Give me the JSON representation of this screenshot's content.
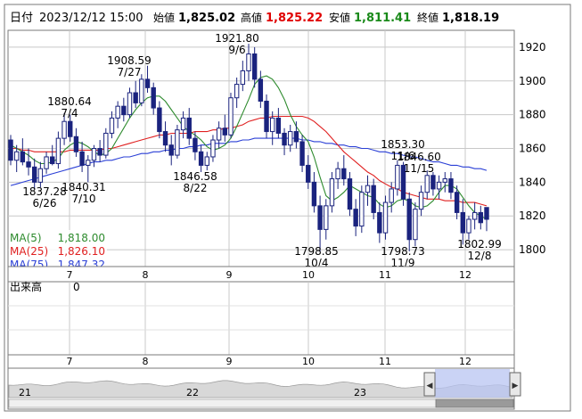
{
  "header": {
    "date_label": "日付",
    "datetime": "2023/12/12 15:00",
    "open_label": "始値",
    "open": "1,825.02",
    "high_label": "高値",
    "high": "1,825.22",
    "low_label": "安値",
    "low": "1,811.41",
    "close_label": "終値",
    "close": "1,818.19"
  },
  "colors": {
    "up": "#1a237e",
    "down": "#1a237e",
    "ma5": "#2e8b2e",
    "ma25": "#e02020",
    "ma75": "#2a3fd6",
    "high_text": "#e00000",
    "low_text": "#1a8a1a",
    "grid": "#c8c8c8",
    "frame": "#666666"
  },
  "chart_data": {
    "type": "candlestick",
    "y_ticks": [
      1800,
      1820,
      1840,
      1860,
      1880,
      1900,
      1920
    ],
    "ylim": [
      1790,
      1930
    ],
    "x_month_ticks": [
      "7",
      "8",
      "9",
      "10",
      "11",
      "12"
    ],
    "grid": true,
    "legend": [
      {
        "name": "MA(5)",
        "value": "1,818.00",
        "color": "#2e8b2e"
      },
      {
        "name": "MA(25)",
        "value": "1,826.10",
        "color": "#e02020"
      },
      {
        "name": "MA(75)",
        "value": "1,847.32",
        "color": "#2a3fd6"
      }
    ],
    "annotations": [
      {
        "value": "1880.64",
        "date": "7/4"
      },
      {
        "value": "1837.28",
        "date": "6/26"
      },
      {
        "value": "1840.31",
        "date": "7/10"
      },
      {
        "value": "1908.59",
        "date": "7/27"
      },
      {
        "value": "1846.58",
        "date": "8/22"
      },
      {
        "value": "1921.80",
        "date": "9/6"
      },
      {
        "value": "1798.85",
        "date": "10/4"
      },
      {
        "value": "1853.30",
        "date": "11/6"
      },
      {
        "value": "1846.60",
        "date": "11/15"
      },
      {
        "value": "1798.73",
        "date": "11/9"
      },
      {
        "value": "1802.99",
        "date": "12/8"
      }
    ],
    "candles": [
      [
        1865,
        1868,
        1850,
        1853
      ],
      [
        1853,
        1862,
        1846,
        1858
      ],
      [
        1858,
        1866,
        1850,
        1852
      ],
      [
        1852,
        1860,
        1844,
        1849
      ],
      [
        1849,
        1854,
        1836,
        1840
      ],
      [
        1840,
        1852,
        1837,
        1848
      ],
      [
        1848,
        1858,
        1845,
        1855
      ],
      [
        1855,
        1862,
        1850,
        1851
      ],
      [
        1851,
        1870,
        1848,
        1866
      ],
      [
        1866,
        1881,
        1862,
        1876
      ],
      [
        1876,
        1880,
        1864,
        1867
      ],
      [
        1867,
        1872,
        1855,
        1858
      ],
      [
        1858,
        1864,
        1846,
        1850
      ],
      [
        1850,
        1856,
        1840,
        1853
      ],
      [
        1853,
        1862,
        1849,
        1860
      ],
      [
        1860,
        1865,
        1852,
        1856
      ],
      [
        1856,
        1872,
        1854,
        1869
      ],
      [
        1869,
        1882,
        1866,
        1878
      ],
      [
        1878,
        1888,
        1872,
        1885
      ],
      [
        1885,
        1890,
        1876,
        1880
      ],
      [
        1880,
        1896,
        1878,
        1893
      ],
      [
        1893,
        1900,
        1884,
        1887
      ],
      [
        1887,
        1904,
        1885,
        1901
      ],
      [
        1901,
        1909,
        1893,
        1896
      ],
      [
        1896,
        1899,
        1880,
        1884
      ],
      [
        1884,
        1888,
        1866,
        1870
      ],
      [
        1870,
        1876,
        1858,
        1862
      ],
      [
        1862,
        1868,
        1850,
        1856
      ],
      [
        1856,
        1874,
        1854,
        1871
      ],
      [
        1871,
        1882,
        1866,
        1878
      ],
      [
        1878,
        1884,
        1862,
        1866
      ],
      [
        1866,
        1870,
        1853,
        1858
      ],
      [
        1858,
        1862,
        1846,
        1850
      ],
      [
        1850,
        1858,
        1847,
        1855
      ],
      [
        1855,
        1868,
        1852,
        1865
      ],
      [
        1865,
        1876,
        1860,
        1872
      ],
      [
        1872,
        1880,
        1864,
        1868
      ],
      [
        1868,
        1893,
        1866,
        1890
      ],
      [
        1890,
        1902,
        1884,
        1898
      ],
      [
        1898,
        1912,
        1894,
        1906
      ],
      [
        1906,
        1922,
        1900,
        1916
      ],
      [
        1916,
        1920,
        1896,
        1901
      ],
      [
        1901,
        1906,
        1884,
        1888
      ],
      [
        1888,
        1892,
        1866,
        1870
      ],
      [
        1870,
        1882,
        1862,
        1878
      ],
      [
        1878,
        1884,
        1866,
        1869
      ],
      [
        1869,
        1872,
        1856,
        1862
      ],
      [
        1862,
        1874,
        1858,
        1870
      ],
      [
        1870,
        1876,
        1860,
        1864
      ],
      [
        1864,
        1868,
        1846,
        1850
      ],
      [
        1850,
        1856,
        1836,
        1840
      ],
      [
        1840,
        1846,
        1822,
        1826
      ],
      [
        1826,
        1832,
        1799,
        1812
      ],
      [
        1812,
        1830,
        1806,
        1826
      ],
      [
        1826,
        1846,
        1822,
        1842
      ],
      [
        1842,
        1852,
        1836,
        1848
      ],
      [
        1848,
        1856,
        1838,
        1842
      ],
      [
        1842,
        1846,
        1820,
        1824
      ],
      [
        1824,
        1830,
        1808,
        1814
      ],
      [
        1814,
        1838,
        1810,
        1834
      ],
      [
        1834,
        1844,
        1826,
        1838
      ],
      [
        1838,
        1842,
        1818,
        1822
      ],
      [
        1822,
        1828,
        1804,
        1810
      ],
      [
        1810,
        1832,
        1806,
        1828
      ],
      [
        1828,
        1840,
        1822,
        1836
      ],
      [
        1836,
        1853,
        1832,
        1850
      ],
      [
        1850,
        1852,
        1826,
        1830
      ],
      [
        1830,
        1834,
        1799,
        1806
      ],
      [
        1806,
        1828,
        1802,
        1824
      ],
      [
        1824,
        1838,
        1820,
        1834
      ],
      [
        1834,
        1847,
        1830,
        1844
      ],
      [
        1844,
        1846,
        1832,
        1836
      ],
      [
        1836,
        1844,
        1830,
        1840
      ],
      [
        1840,
        1846,
        1834,
        1842
      ],
      [
        1842,
        1846,
        1830,
        1834
      ],
      [
        1834,
        1838,
        1818,
        1822
      ],
      [
        1822,
        1830,
        1803,
        1810
      ],
      [
        1810,
        1820,
        1806,
        1818
      ],
      [
        1818,
        1828,
        1812,
        1822
      ],
      [
        1822,
        1826,
        1812,
        1816
      ],
      [
        1825,
        1825,
        1811,
        1818
      ]
    ],
    "ma5": [
      1862,
      1860,
      1858,
      1856,
      1853,
      1851,
      1851,
      1852,
      1854,
      1859,
      1862,
      1864,
      1863,
      1861,
      1858,
      1856,
      1857,
      1860,
      1866,
      1872,
      1878,
      1883,
      1887,
      1890,
      1891,
      1891,
      1888,
      1883,
      1878,
      1873,
      1870,
      1868,
      1865,
      1861,
      1859,
      1860,
      1862,
      1866,
      1873,
      1881,
      1889,
      1898,
      1902,
      1903,
      1901,
      1896,
      1889,
      1880,
      1873,
      1868,
      1864,
      1855,
      1843,
      1832,
      1829,
      1831,
      1834,
      1838,
      1836,
      1834,
      1832,
      1831,
      1827,
      1825,
      1826,
      1829,
      1830,
      1829,
      1826,
      1825,
      1826,
      1829,
      1834,
      1838,
      1838,
      1836,
      1831,
      1826,
      1822,
      1820,
      1818
    ],
    "ma25": [
      1860,
      1860,
      1859,
      1859,
      1858,
      1858,
      1858,
      1858,
      1858,
      1858,
      1859,
      1859,
      1859,
      1859,
      1859,
      1859,
      1860,
      1860,
      1861,
      1862,
      1863,
      1864,
      1865,
      1866,
      1867,
      1868,
      1868,
      1869,
      1869,
      1869,
      1869,
      1870,
      1870,
      1870,
      1871,
      1871,
      1872,
      1872,
      1873,
      1874,
      1876,
      1877,
      1878,
      1878,
      1879,
      1879,
      1879,
      1879,
      1879,
      1879,
      1878,
      1876,
      1873,
      1870,
      1866,
      1862,
      1858,
      1855,
      1852,
      1849,
      1846,
      1844,
      1841,
      1839,
      1837,
      1836,
      1834,
      1833,
      1832,
      1831,
      1830,
      1830,
      1830,
      1829,
      1829,
      1829,
      1828,
      1828,
      1828,
      1827,
      1826
    ],
    "ma75": [
      1838,
      1839,
      1840,
      1841,
      1842,
      1843,
      1844,
      1845,
      1846,
      1847,
      1848,
      1849,
      1850,
      1851,
      1852,
      1852,
      1853,
      1853,
      1854,
      1855,
      1855,
      1856,
      1857,
      1857,
      1858,
      1858,
      1859,
      1859,
      1860,
      1860,
      1861,
      1861,
      1862,
      1862,
      1863,
      1863,
      1863,
      1864,
      1864,
      1865,
      1865,
      1866,
      1866,
      1866,
      1866,
      1866,
      1866,
      1866,
      1866,
      1865,
      1865,
      1864,
      1864,
      1863,
      1863,
      1862,
      1862,
      1861,
      1861,
      1860,
      1860,
      1859,
      1858,
      1858,
      1857,
      1857,
      1856,
      1855,
      1855,
      1854,
      1853,
      1852,
      1852,
      1851,
      1850,
      1850,
      1849,
      1849,
      1848,
      1848,
      1847
    ]
  },
  "volume_panel": {
    "label": "出来高",
    "value": "0",
    "x_month_ticks": [
      "7",
      "8",
      "9",
      "10",
      "11",
      "12"
    ]
  },
  "navigator": {
    "labels": [
      "21",
      "22",
      "23"
    ],
    "left_arrow": "◀",
    "right_arrow": "▶"
  }
}
